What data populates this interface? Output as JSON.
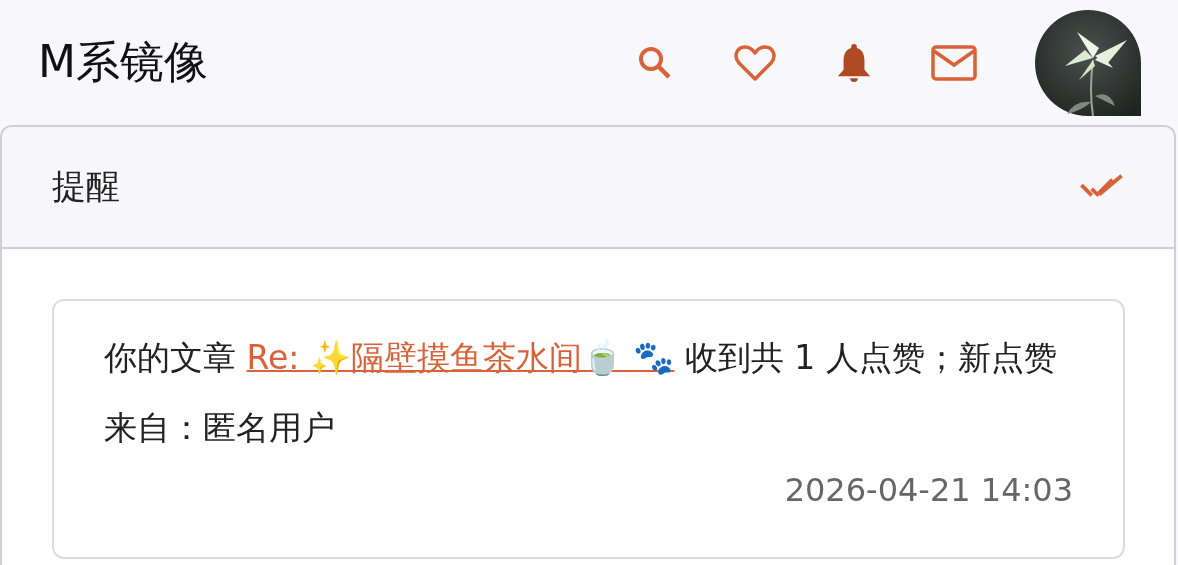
{
  "header": {
    "title": "M系镜像"
  },
  "panel": {
    "title": "提醒"
  },
  "notifications": [
    {
      "prefix": "你的文章 ",
      "link": "Re: ✨隔壁摸鱼茶水间🍵 🐾",
      "suffix": " 收到共 1 人点赞；新点赞来自：匿名用户",
      "time": "2026-04-21 14:03"
    }
  ]
}
